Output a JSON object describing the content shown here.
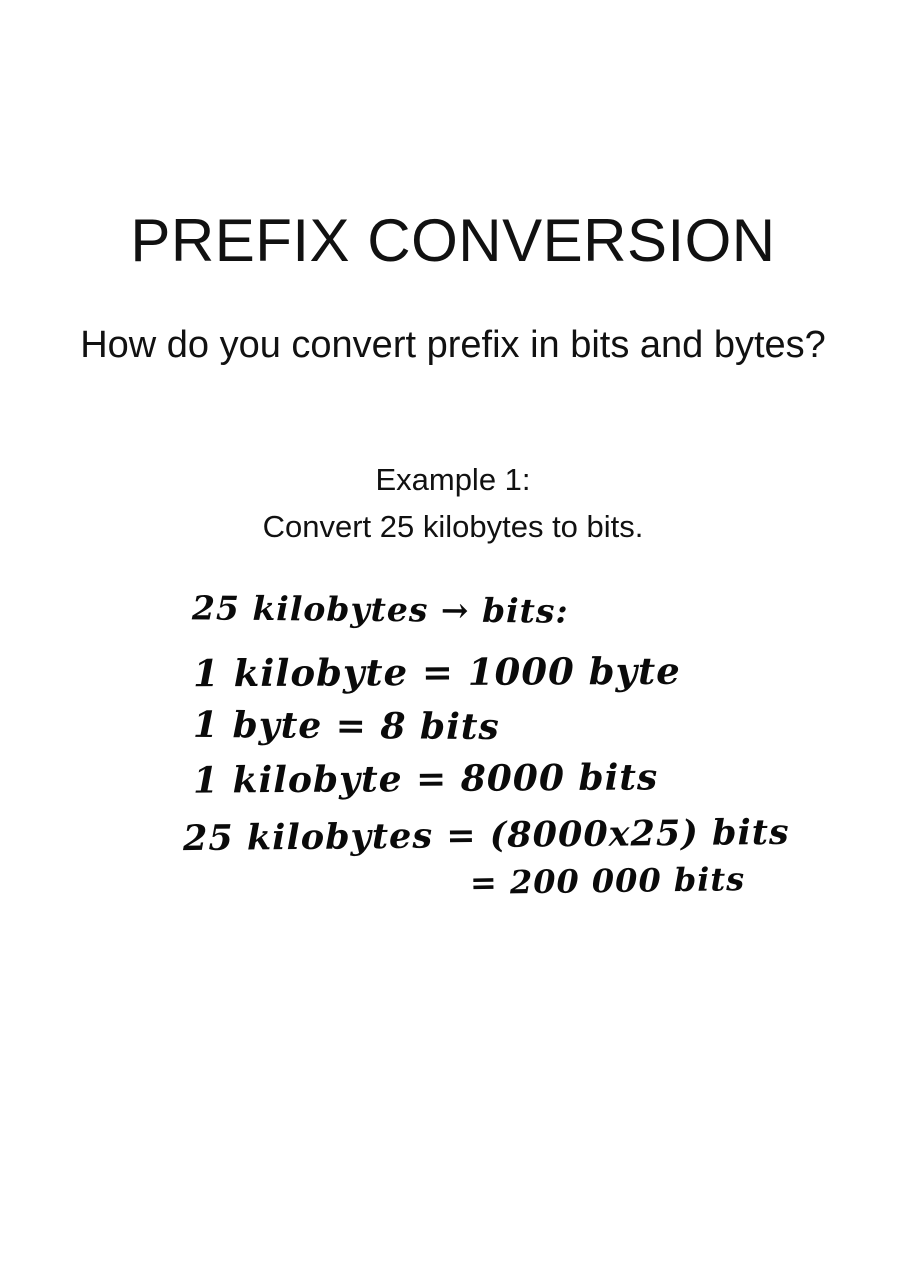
{
  "document": {
    "title": "PREFIX CONVERSION",
    "subtitle": "How do you convert prefix in bits and bytes?",
    "example": {
      "heading": "Example 1:",
      "question": "Convert 25 kilobytes to bits."
    },
    "handwritten_work": {
      "line1": "25 kilobytes → bits:",
      "line2": "1 kilobyte = 1000 byte",
      "line3": "1 byte = 8 bits",
      "line4": "1 kilobyte = 8000 bits",
      "line5": "25 kilobytes = (8000x25) bits",
      "line6": "= 200 000 bits"
    }
  }
}
